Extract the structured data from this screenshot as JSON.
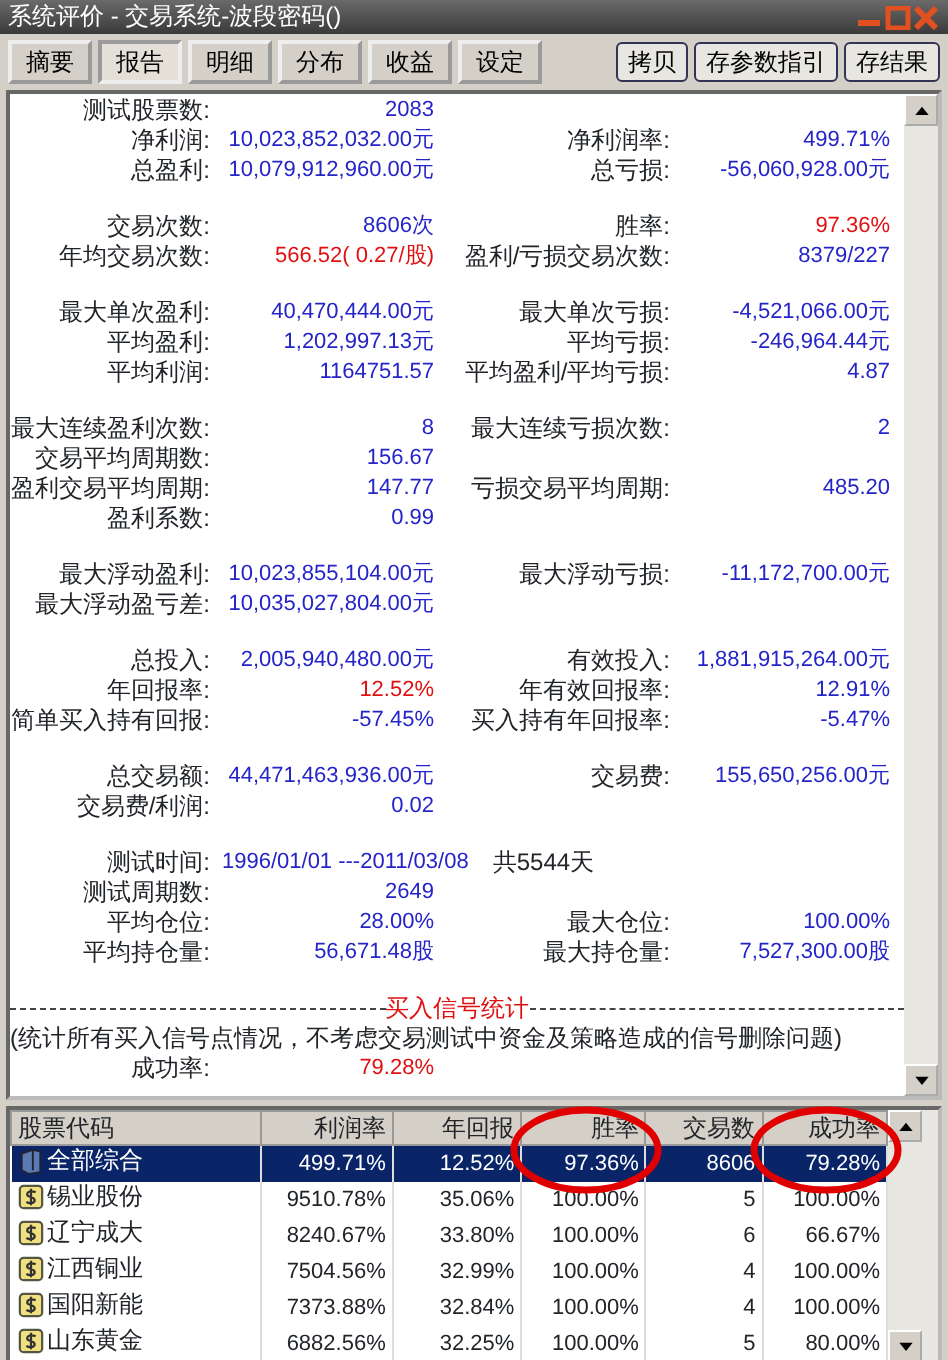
{
  "window": {
    "title": "系统评价 - 交易系统-波段密码()"
  },
  "tabs": [
    {
      "label": "摘要",
      "selected": false
    },
    {
      "label": "报告",
      "selected": true
    },
    {
      "label": "明细",
      "selected": false
    },
    {
      "label": "分布",
      "selected": false
    },
    {
      "label": "收益",
      "selected": false
    },
    {
      "label": "设定",
      "selected": false
    }
  ],
  "buttons": [
    "拷贝",
    "存参数指引",
    "存结果"
  ],
  "report": {
    "groups": [
      [
        {
          "cells": [
            {
              "label": "测试股票数:",
              "value": "2083",
              "highlight": false
            }
          ]
        },
        {
          "cells": [
            {
              "label": "净利润:",
              "value": "10,023,852,032.00元",
              "highlight": false
            },
            {
              "label": "净利润率:",
              "value": "499.71%",
              "highlight": false
            }
          ]
        },
        {
          "cells": [
            {
              "label": "总盈利:",
              "value": "10,079,912,960.00元",
              "highlight": false
            },
            {
              "label": "总亏损:",
              "value": "-56,060,928.00元",
              "highlight": false
            }
          ]
        }
      ],
      [
        {
          "cells": [
            {
              "label": "交易次数:",
              "value": "8606次",
              "highlight": false
            },
            {
              "label": "胜率:",
              "value": "97.36%",
              "highlight": true
            }
          ]
        },
        {
          "cells": [
            {
              "label": "年均交易次数:",
              "value": "566.52( 0.27/股)",
              "highlight": true
            },
            {
              "label": "盈利/亏损交易次数:",
              "value": "8379/227",
              "highlight": false
            }
          ]
        }
      ],
      [
        {
          "cells": [
            {
              "label": "最大单次盈利:",
              "value": "40,470,444.00元",
              "highlight": false
            },
            {
              "label": "最大单次亏损:",
              "value": "-4,521,066.00元",
              "highlight": false
            }
          ]
        },
        {
          "cells": [
            {
              "label": "平均盈利:",
              "value": "1,202,997.13元",
              "highlight": false
            },
            {
              "label": "平均亏损:",
              "value": "-246,964.44元",
              "highlight": false
            }
          ]
        },
        {
          "cells": [
            {
              "label": "平均利润:",
              "value": "1164751.57",
              "highlight": false
            },
            {
              "label": "平均盈利/平均亏损:",
              "value": "4.87",
              "highlight": false
            }
          ]
        }
      ],
      [
        {
          "cells": [
            {
              "label": "最大连续盈利次数:",
              "value": "8",
              "highlight": false
            },
            {
              "label": "最大连续亏损次数:",
              "value": "2",
              "highlight": false
            }
          ]
        },
        {
          "cells": [
            {
              "label": "交易平均周期数:",
              "value": "156.67",
              "highlight": false
            }
          ]
        },
        {
          "cells": [
            {
              "label": "盈利交易平均周期:",
              "value": "147.77",
              "highlight": false
            },
            {
              "label": "亏损交易平均周期:",
              "value": "485.20",
              "highlight": false
            }
          ]
        },
        {
          "cells": [
            {
              "label": "盈利系数:",
              "value": "0.99",
              "highlight": false
            }
          ]
        }
      ],
      [
        {
          "cells": [
            {
              "label": "最大浮动盈利:",
              "value": "10,023,855,104.00元",
              "highlight": false
            },
            {
              "label": "最大浮动亏损:",
              "value": "-11,172,700.00元",
              "highlight": false
            }
          ]
        },
        {
          "cells": [
            {
              "label": "最大浮动盈亏差:",
              "value": "10,035,027,804.00元",
              "highlight": false
            }
          ]
        }
      ],
      [
        {
          "cells": [
            {
              "label": "总投入:",
              "value": "2,005,940,480.00元",
              "highlight": false
            },
            {
              "label": "有效投入:",
              "value": "1,881,915,264.00元",
              "highlight": false
            }
          ]
        },
        {
          "cells": [
            {
              "label": "年回报率:",
              "value": "12.52%",
              "highlight": true
            },
            {
              "label": "年有效回报率:",
              "value": "12.91%",
              "highlight": false
            }
          ]
        },
        {
          "cells": [
            {
              "label": "简单买入持有回报:",
              "value": "-57.45%",
              "highlight": false
            },
            {
              "label": "买入持有年回报率:",
              "value": "-5.47%",
              "highlight": false
            }
          ]
        }
      ],
      [
        {
          "cells": [
            {
              "label": "总交易额:",
              "value": "44,471,463,936.00元",
              "highlight": false
            },
            {
              "label": "交易费:",
              "value": "155,650,256.00元",
              "highlight": false
            }
          ]
        },
        {
          "cells": [
            {
              "label": "交易费/利润:",
              "value": "0.02",
              "highlight": false
            }
          ]
        }
      ],
      [
        {
          "kind": "period",
          "label": "测试时间:",
          "value": "1996/01/01 ---2011/03/08",
          "suffix": "共5544天"
        },
        {
          "cells": [
            {
              "label": "测试周期数:",
              "value": "2649",
              "highlight": false
            }
          ]
        },
        {
          "cells": [
            {
              "label": "平均仓位:",
              "value": "28.00%",
              "highlight": false
            },
            {
              "label": "最大仓位:",
              "value": "100.00%",
              "highlight": false
            }
          ]
        },
        {
          "cells": [
            {
              "label": "平均持仓量:",
              "value": "56,671.48股",
              "highlight": false
            },
            {
              "label": "最大持仓量:",
              "value": "7,527,300.00股",
              "highlight": false
            }
          ]
        }
      ]
    ],
    "signal": {
      "heading": "买入信号统计",
      "note": "(统计所有买入信号点情况，不考虑交易测试中资金及策略造成的信号删除问题)",
      "rows": [
        {
          "cells": [
            {
              "label": "成功率:",
              "value": "79.28%",
              "highlight": true
            }
          ]
        }
      ]
    }
  },
  "table": {
    "columns": [
      "股票代码",
      "利润率",
      "年回报",
      "胜率",
      "交易数",
      "成功率"
    ],
    "rows": [
      {
        "kind": "summary",
        "selected": true,
        "cells": [
          "全部综合",
          "499.71%",
          "12.52%",
          "97.36%",
          "8606",
          "79.28%"
        ]
      },
      {
        "kind": "stock",
        "selected": false,
        "cells": [
          "锡业股份",
          "9510.78%",
          "35.06%",
          "100.00%",
          "5",
          "100.00%"
        ]
      },
      {
        "kind": "stock",
        "selected": false,
        "cells": [
          "辽宁成大",
          "8240.67%",
          "33.80%",
          "100.00%",
          "6",
          "66.67%"
        ]
      },
      {
        "kind": "stock",
        "selected": false,
        "cells": [
          "江西铜业",
          "7504.56%",
          "32.99%",
          "100.00%",
          "4",
          "100.00%"
        ]
      },
      {
        "kind": "stock",
        "selected": false,
        "cells": [
          "国阳新能",
          "7373.88%",
          "32.84%",
          "100.00%",
          "4",
          "100.00%"
        ]
      },
      {
        "kind": "stock",
        "selected": false,
        "cells": [
          "山东黄金",
          "6882.56%",
          "32.25%",
          "100.00%",
          "5",
          "80.00%"
        ]
      }
    ]
  },
  "annotations": [
    {
      "kind": "circle"
    },
    {
      "kind": "circle"
    }
  ]
}
